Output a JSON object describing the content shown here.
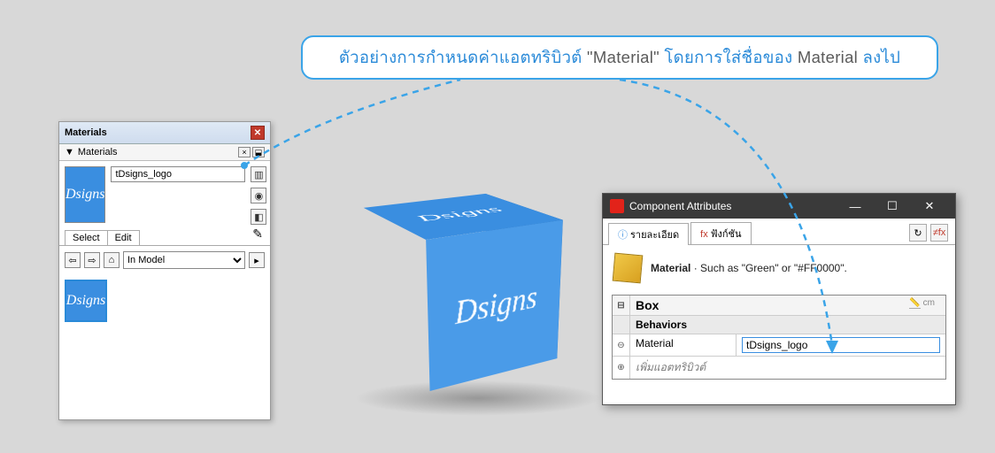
{
  "callout": {
    "prefix": "ตัวอย่างการกำหนดค่าแอตทริบิวต์ ",
    "quoted": "\"Material\"",
    "middle": " โดยการใส่ชื่อของ ",
    "term": "Material",
    "suffix": " ลงไป"
  },
  "materials_panel": {
    "title": "Materials",
    "subtitle": "Materials",
    "current_material_name": "tDsigns_logo",
    "tabs": {
      "select": "Select",
      "edit": "Edit"
    },
    "library_select": "In Model",
    "logo_text": "Dsigns"
  },
  "cube": {
    "face_text": "Dsigns"
  },
  "component_attributes": {
    "title": "Component Attributes",
    "tabs": {
      "details": "รายละเอียด",
      "functions": "ฟังก์ชัน"
    },
    "info_label": "Material",
    "info_desc": " · Such as \"Green\" or \"#FF0000\".",
    "grid": {
      "component_name": "Box",
      "unit": "cm",
      "section": "Behaviors",
      "rows": [
        {
          "attr": "Material",
          "value": "tDsigns_logo"
        }
      ],
      "add_label": "เพิ่มแอตทริบิวต์"
    }
  }
}
